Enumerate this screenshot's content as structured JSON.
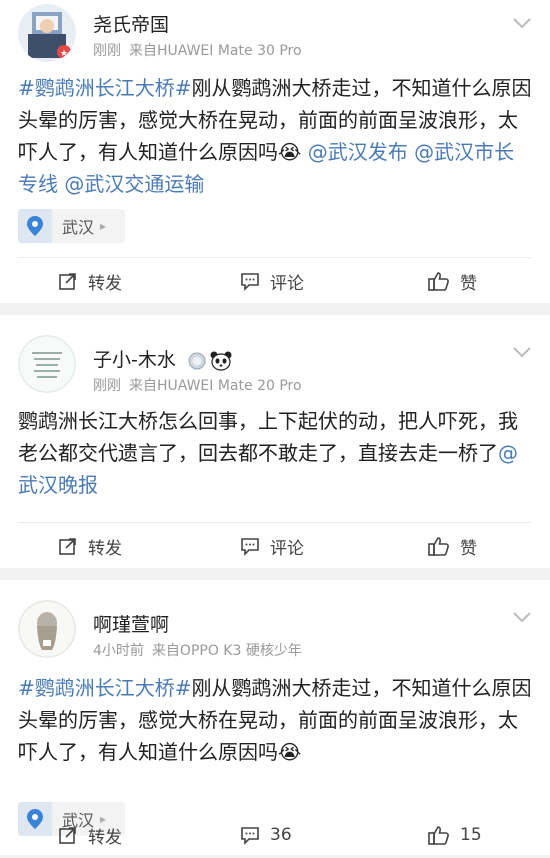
{
  "posts": [
    {
      "user": "尧氏帝国",
      "time": "刚刚",
      "source": "来自HUAWEI Mate 30 Pro",
      "content": [
        {
          "text": "#鹦鹉洲长江大桥#",
          "link": true
        },
        {
          "text": "刚从鹦鹉洲大桥走过，不知道什么原因头晕的厉害，感觉大桥在晃动，前面的前面呈波浪形，太吓人了，有人知道什么原因吗",
          "link": false
        },
        {
          "text": "😭",
          "link": false
        },
        {
          "text": " @武汉发布 @武汉市长专线 @武汉交通运输",
          "link": true
        }
      ],
      "location": "武汉",
      "repost": "转发",
      "comment": "评论",
      "like": "赞"
    },
    {
      "user": "子小-木水",
      "time": "刚刚",
      "source": "来自HUAWEI Mate 20 Pro",
      "content": [
        {
          "text": "鹦鹉洲长江大桥怎么回事，上下起伏的动，把人吓死，我老公都交代遗言了，回去都不敢走了，直接去走一桥了",
          "link": false
        },
        {
          "text": "@武汉晚报",
          "link": true
        }
      ],
      "repost": "转发",
      "comment": "评论",
      "like": "赞"
    },
    {
      "user": "啊瑾萱啊",
      "time": "4小时前",
      "source": "来自OPPO K3 硬核少年",
      "content": [
        {
          "text": "#鹦鹉洲长江大桥#",
          "link": true
        },
        {
          "text": "刚从鹦鹉洲大桥走过，不知道什么原因头晕的厉害，感觉大桥在晃动，前面的前面呈波浪形，太吓人了，有人知道什么原因吗",
          "link": false
        },
        {
          "text": "😭",
          "link": false
        }
      ],
      "location": "武汉",
      "repost": "转发",
      "comment": "36",
      "like": "15"
    }
  ],
  "colors": {
    "link": "#4b7bb5",
    "background": "#f2f2f2",
    "divider": "#ececec"
  }
}
